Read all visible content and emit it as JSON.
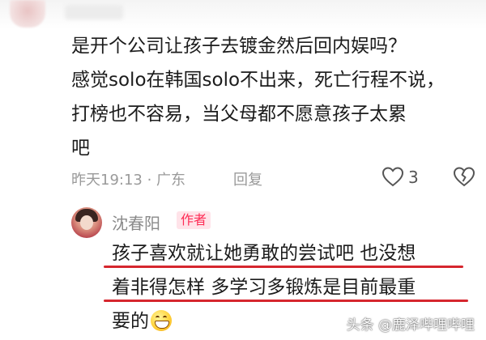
{
  "comment": {
    "lines": [
      "是开个公司让孩子去镀金然后回内娱吗？",
      "感觉solo在韩国solo不出来，死亡行程不说，",
      "打榜也不容易，当父母都不愿意孩子太累",
      "吧"
    ],
    "time_location": "昨天19:13 · 广东",
    "reply_label": "回复",
    "like_count": "3"
  },
  "reply": {
    "author": "沈春阳",
    "badge": "作者",
    "lines": [
      "孩子喜欢就让她勇敢的尝试吧 也没想",
      "着非得怎样 多学习多锻炼是目前最重",
      "要的"
    ],
    "emoji": "grinning-face"
  },
  "watermark": "头条 @鹿泽哔哩哔哩",
  "colors": {
    "underline": "#d6262e",
    "badge_text": "#fe2c55",
    "badge_bg": "#ffe3e9",
    "meta_text": "#9a9a9a"
  }
}
